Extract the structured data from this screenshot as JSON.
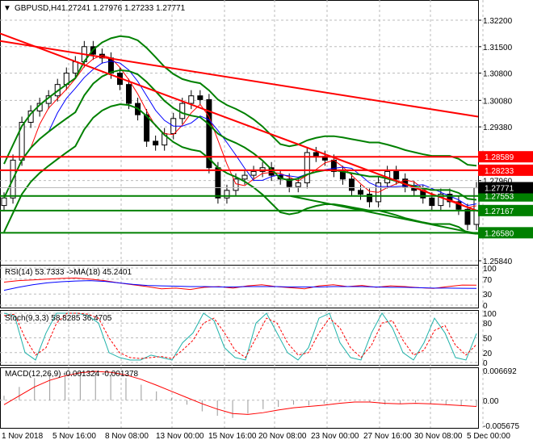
{
  "header": {
    "symbol": "GBPUSD,H4",
    "open": "1.27241",
    "high": "1.27976",
    "low": "1.27233",
    "close": "1.27771"
  },
  "chart_data": {
    "type": "line",
    "title": "GBPUSD,H4",
    "ylim": [
      1.2584,
      1.322
    ],
    "price_ticks": [
      "1.32200",
      "1.31500",
      "1.30800",
      "1.30080",
      "1.29380",
      "1.27960",
      "1.25840"
    ],
    "price_tick_values": [
      1.322,
      1.315,
      1.308,
      1.3008,
      1.2938,
      1.2796,
      1.2584
    ],
    "time_labels": [
      "1 Nov 2018",
      "5 Nov 16:00",
      "8 Nov 08:00",
      "13 Nov 00:00",
      "15 Nov 16:00",
      "20 Nov 08:00",
      "23 Nov 00:00",
      "27 Nov 16:00",
      "30 Nov 08:00",
      "5 Dec 00:00"
    ],
    "closes": [
      1.275,
      1.285,
      1.295,
      1.298,
      1.3,
      1.302,
      1.305,
      1.308,
      1.311,
      1.315,
      1.313,
      1.312,
      1.308,
      1.305,
      1.3,
      1.297,
      1.29,
      1.289,
      1.292,
      1.296,
      1.3,
      1.302,
      1.301,
      1.283,
      1.275,
      1.277,
      1.28,
      1.281,
      1.282,
      1.283,
      1.281,
      1.28,
      1.278,
      1.279,
      1.287,
      1.286,
      1.285,
      1.282,
      1.28,
      1.277,
      1.276,
      1.274,
      1.279,
      1.282,
      1.28,
      1.278,
      1.277,
      1.275,
      1.273,
      1.276,
      1.274,
      1.272,
      1.268,
      1.2777
    ],
    "levels": [
      {
        "label": "1.28589",
        "value": 1.28589,
        "color": "#ff0000"
      },
      {
        "label": "1.28233",
        "value": 1.28233,
        "color": "#ff0000"
      },
      {
        "label": "1.27553",
        "value": 1.27553,
        "color": "#008000"
      },
      {
        "label": "1.27167",
        "value": 1.27167,
        "color": "#008000"
      },
      {
        "label": "1.26580",
        "value": 1.2658,
        "color": "#008000"
      }
    ],
    "current": {
      "label": "1.27771",
      "value": 1.27771
    },
    "rsi": {
      "label": "RSI(14) 53.7333  ->MA(18) 45.2401",
      "ticks": [
        "100",
        "70",
        "30",
        "0"
      ],
      "rsi": [
        62,
        66,
        68,
        70,
        72,
        73,
        70,
        66,
        60,
        55,
        50,
        44,
        46,
        42,
        48,
        50,
        46,
        52,
        55,
        50,
        47,
        44,
        52,
        55,
        50,
        53,
        48,
        52,
        50,
        47,
        45,
        50,
        54,
        53.7
      ],
      "ma": [
        40,
        48,
        55,
        60,
        63,
        65,
        66,
        64,
        60,
        56,
        53,
        52,
        51,
        50,
        50,
        49,
        49,
        50,
        50,
        50,
        49,
        49,
        49,
        50,
        50,
        50,
        49,
        48,
        48,
        47,
        46,
        46,
        45.5,
        45.2
      ]
    },
    "stoch": {
      "label": "Stoch(9,3,3) 58.8285 36.4705",
      "ticks": [
        "100",
        "80",
        "50",
        "20",
        "0"
      ],
      "k": [
        100,
        95,
        20,
        5,
        60,
        100,
        100,
        100,
        95,
        80,
        20,
        10,
        5,
        5,
        15,
        10,
        5,
        40,
        60,
        100,
        85,
        30,
        10,
        5,
        80,
        100,
        60,
        20,
        5,
        30,
        90,
        100,
        40,
        10,
        5,
        60,
        100,
        70,
        20,
        5,
        40,
        90,
        60,
        10,
        5,
        58.8
      ],
      "d": [
        95,
        98,
        50,
        15,
        30,
        80,
        100,
        100,
        98,
        90,
        50,
        20,
        10,
        8,
        10,
        12,
        8,
        25,
        45,
        80,
        90,
        60,
        25,
        10,
        50,
        90,
        80,
        40,
        15,
        20,
        60,
        90,
        70,
        30,
        10,
        35,
        80,
        85,
        45,
        15,
        25,
        65,
        75,
        35,
        15,
        36.5
      ]
    },
    "macd": {
      "label": "MACD(12,26,9) -0.001324 -0.001378",
      "ticks": [
        "0.006692",
        "0.00",
        "-0.005675"
      ],
      "hist": [
        0.001,
        0.003,
        0.005,
        0.006,
        0.0065,
        0.0066,
        0.0065,
        0.006,
        0.005,
        0.0035,
        0.002,
        0.0005,
        -0.001,
        -0.0025,
        -0.0035,
        -0.004,
        -0.003,
        -0.002,
        -0.0015,
        -0.001,
        -0.0012,
        -0.0008,
        -0.0003,
        0,
        -0.0005,
        -0.001,
        -0.0008,
        -0.0005,
        -0.0008,
        -0.001,
        -0.0012,
        -0.0013
      ],
      "signal": [
        -0.001,
        0.001,
        0.003,
        0.0045,
        0.0055,
        0.0062,
        0.0065,
        0.0063,
        0.0057,
        0.0047,
        0.0034,
        0.002,
        0.0006,
        -0.0008,
        -0.002,
        -0.003,
        -0.0032,
        -0.0028,
        -0.0022,
        -0.0017,
        -0.0014,
        -0.0011,
        -0.0007,
        -0.0004,
        -0.0004,
        -0.0007,
        -0.0008,
        -0.0007,
        -0.0008,
        -0.001,
        -0.0012,
        -0.0014
      ]
    }
  }
}
